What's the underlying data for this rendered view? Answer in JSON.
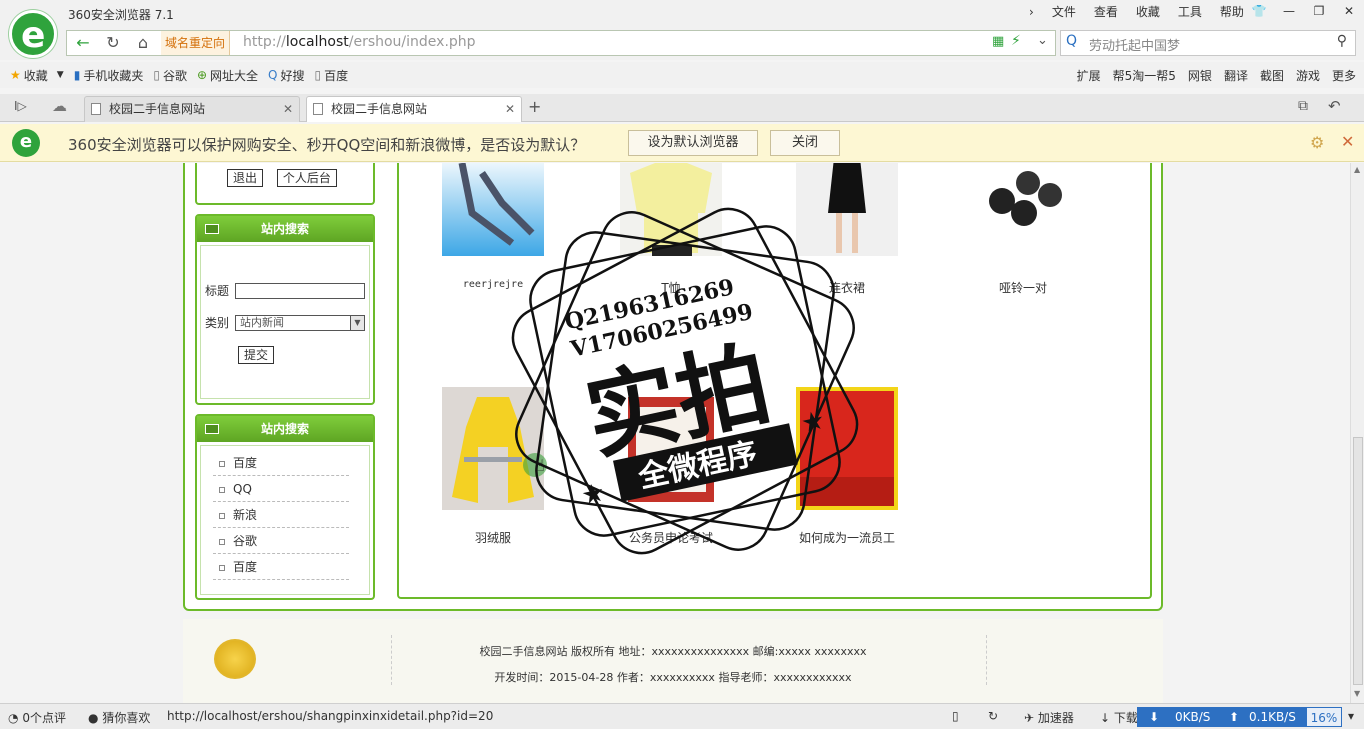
{
  "browser": {
    "title": "360安全浏览器 7.1",
    "menu": [
      "文件",
      "查看",
      "收藏",
      "工具",
      "帮助"
    ],
    "address": {
      "redirect_label": "域名重定向",
      "url_prefix": "http://",
      "url_host": "localhost",
      "url_path": "/ershou/index.php"
    },
    "search_placeholder": "劳动托起中国梦",
    "bookmarks": [
      "收藏",
      "手机收藏夹",
      "谷歌",
      "网址大全",
      "好搜",
      "百度"
    ],
    "toolbar_right": [
      "扩展",
      "帮5淘一帮5",
      "网银",
      "翻译",
      "截图",
      "游戏",
      "更多"
    ],
    "tabs": [
      {
        "label": "校园二手信息网站",
        "active": false
      },
      {
        "label": "校园二手信息网站",
        "active": true
      }
    ],
    "notification": {
      "message": "360安全浏览器可以保护网购安全、秒开QQ空间和新浪微博，是否设为默认？",
      "set_default": "设为默认浏览器",
      "close": "关闭"
    }
  },
  "page": {
    "user_box": {
      "logout": "退出",
      "backend": "个人后台"
    },
    "search_box": {
      "title": "站内搜索",
      "title_label": "标题",
      "category_label": "类别",
      "category_value": "站内新闻",
      "submit": "提交"
    },
    "links_box": {
      "title": "站内搜索",
      "links": [
        "百度",
        "QQ",
        "新浪",
        "谷歌",
        "百度"
      ]
    },
    "products": [
      {
        "name": "reerjrejre"
      },
      {
        "name": "T恤"
      },
      {
        "name": "连衣裙"
      },
      {
        "name": "哑铃一对"
      },
      {
        "name": "羽绒服"
      },
      {
        "name": "公务员申论考试"
      },
      {
        "name": "如何成为一流员工"
      }
    ],
    "footer": {
      "line1": "校园二手信息网站 版权所有 地址：xxxxxxxxxxxxxxx 邮编:xxxxx xxxxxxxx",
      "line2": "开发时间：2015-04-28 作者：xxxxxxxxxx 指导老师：xxxxxxxxxxxx"
    }
  },
  "watermark": {
    "qq": "Q2196316269",
    "v": "V17060256499",
    "big": "实拍",
    "banner": "全微程序"
  },
  "statusbar": {
    "comments": "0个点评",
    "guess": "猜你喜欢",
    "link_url": "http://localhost/ershou/shangpinxinxidetail.php?id=20",
    "accelerator": "加速器",
    "download": "下载",
    "down_speed": "0KB/S",
    "up_speed": "0.1KB/S",
    "percent": "16%"
  },
  "colors": {
    "accent_green": "#6cba2a",
    "browser_green": "#2fa33c",
    "speed_blue": "#2d70c2",
    "notify_bg": "#fdf7d3"
  }
}
